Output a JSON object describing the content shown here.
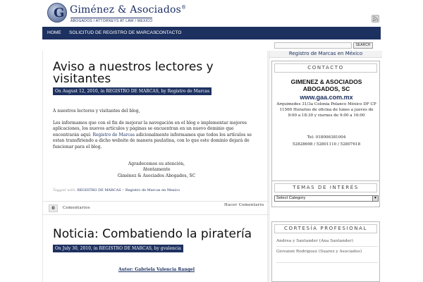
{
  "brand": {
    "name": "Giménez & Asociados",
    "mark": "®",
    "tagline": "ABOGADOS / ATTORNEYS AT LAW / MEXICO"
  },
  "nav": {
    "items": [
      {
        "label": "HOME"
      },
      {
        "label": "SOLICITUD DE REGISTRO DE MARCAS"
      },
      {
        "label": "CONTACTO"
      }
    ]
  },
  "search": {
    "value": "",
    "button_label": "SEARCH"
  },
  "posts": [
    {
      "title": "Aviso a nuestros lectores y visitantes",
      "meta": "On August 12, 2010, in REGISTRO DE MARCAS, by Registro de Marcas",
      "body_p1": "A nuestros lectores y visitantes del blog,",
      "body_p2_a": "Les informamos que con el fin de mejorar la navegación en el blog e implementar mejores aplicaciones, los nuevos artículos y páginas se encuentran en un nuevo dominio que encontrarán aquí: ",
      "body_p2_link": "Registro de Marcas",
      "body_p2_b": " adicionalmente informamos que todos los artículos se estan transfiriendo a dicho website de manera paulatina, con lo que este dominio dejará de funcionar para el blog.",
      "sign_1": "Agradecemos su atención,",
      "sign_2": "Atentamente",
      "sign_3": "Giménez & Asociados Abogados, SC",
      "tags_label": "Tagged with:",
      "tag_1": "REGISTRO DE MARCAS",
      "tag_sep": " • ",
      "tag_2": "Registro de Marcas en Mexico",
      "comment_count": "0",
      "comment_label": "Comentarios",
      "comment_action": "Hacer Comentario"
    },
    {
      "title": "Noticia: Combatiendo la piratería",
      "meta": "On July 30, 2010, in REGISTRO DE MARCAS, by gvalencia",
      "author": "Autor: Gabriela Valencia Rangel"
    }
  ],
  "sidebar": {
    "top_link": "Registro de Marcas en México",
    "contact": {
      "heading": "CONTACTO",
      "name_1": "GIMENEZ & ASOCIADOS",
      "name_2": "ABOGADOS, SC",
      "website": "www.gaa.com.mx",
      "address": "Arquimedes 31/3a Colonia Polanco México DF CP 11560 Horarios de oficina de lunes a jueves de 9:00 a 18:30 y viernes de 9:00 a 16:00",
      "tel": "Tel: 018006381004",
      "phones": "52828698 / 52801110 / 52807618"
    },
    "topics": {
      "heading": "TEMAS DE INTERÉS",
      "selected": "Select Category"
    },
    "courtesy": {
      "heading": "CORTESÍA PROFESIONAL",
      "items": [
        "Andrea y Santander (Ana Santander)",
        "Giovanni Rodriguez (Suarez y Asociados)"
      ]
    }
  },
  "colors": {
    "navy": "#1d3160",
    "page_bg": "#ffffff"
  }
}
